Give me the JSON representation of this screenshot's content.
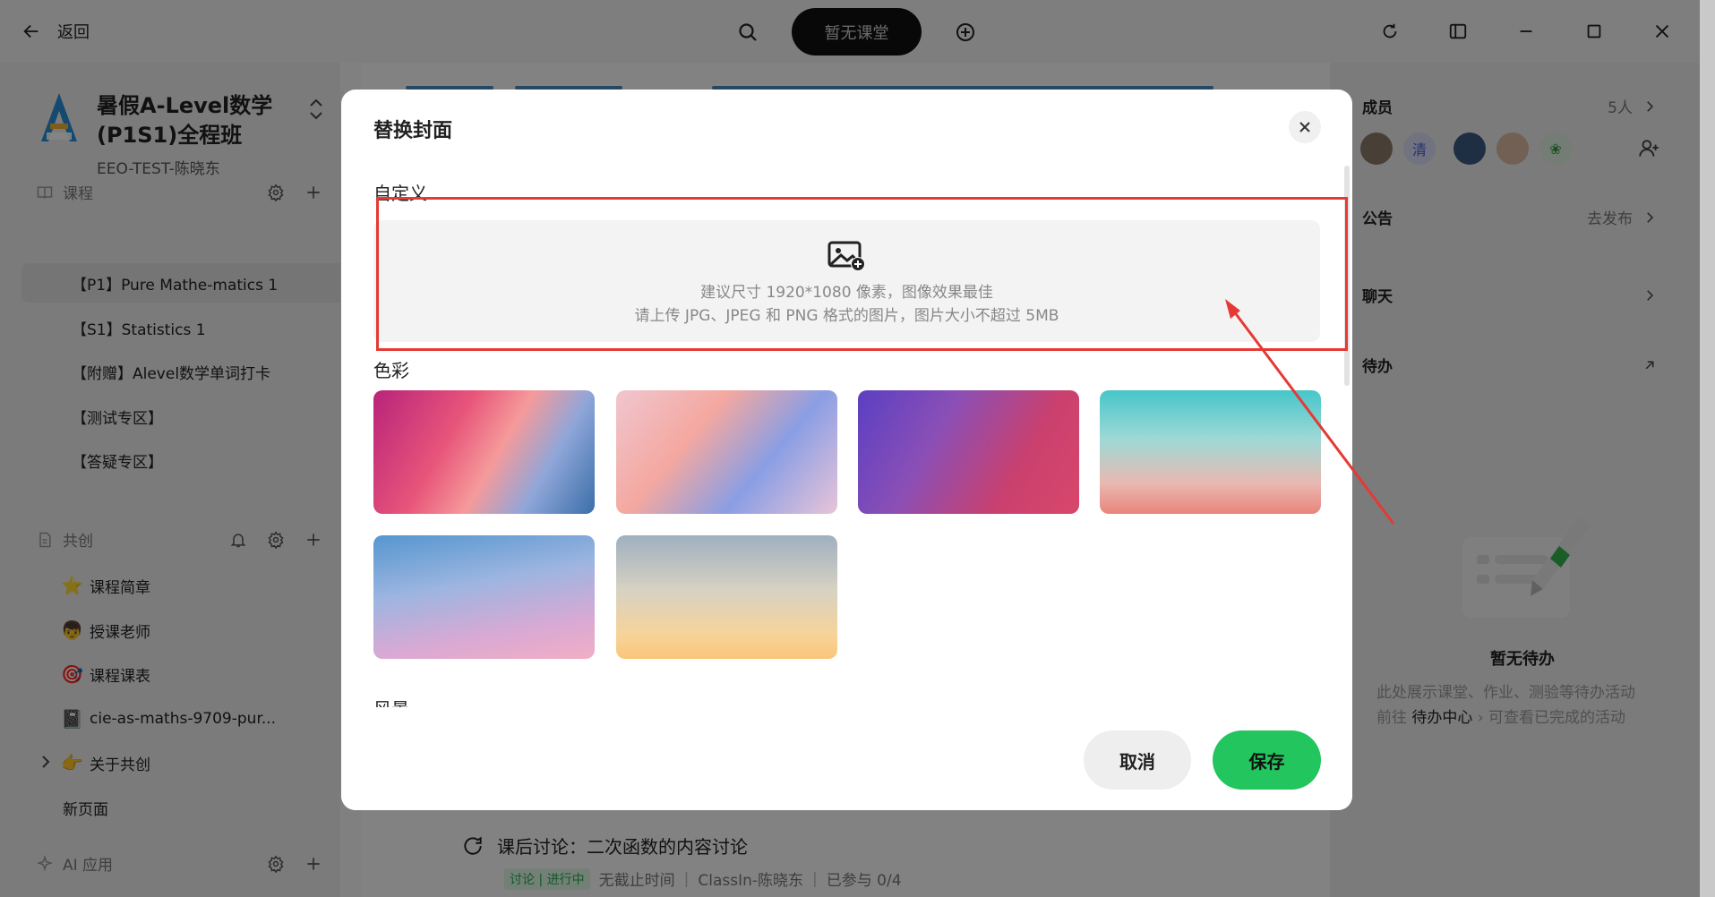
{
  "topbar": {
    "back_label": "返回",
    "class_status": "暂无课堂"
  },
  "sidebar": {
    "course_title": "暑假A-Level数学(P1S1)全程班",
    "course_sub": "EEO-TEST-陈晓东",
    "sections": {
      "course": "课程",
      "cocreate": "共创",
      "ai": "AI 应用"
    },
    "course_items": [
      {
        "label": "【P1】Pure Mathe-matics 1",
        "active": true
      },
      {
        "label": "【S1】Statistics 1"
      },
      {
        "label": "【附赠】Alevel数学单词打卡"
      },
      {
        "label": "【测试专区】"
      },
      {
        "label": "【答疑专区】"
      }
    ],
    "cocreate_items": [
      {
        "label": "课程简章",
        "icon": "star-icon",
        "glyph": "⭐"
      },
      {
        "label": "授课老师",
        "icon": "teacher-icon",
        "glyph": "👦"
      },
      {
        "label": "课程课表",
        "icon": "target-icon",
        "glyph": "🎯"
      },
      {
        "label": "cie-as-maths-9709-pur...",
        "icon": "notebook-icon",
        "glyph": "📓"
      },
      {
        "label": "关于共创",
        "icon": "pointing-hand-icon",
        "glyph": "👉"
      },
      {
        "label": "新页面"
      }
    ]
  },
  "main": {
    "discussion_title": "课后讨论：二次函数的内容讨论",
    "discussion_tag": "讨论 | 进行中",
    "discussion_deadline": "无截止时间",
    "discussion_author": "ClassIn-陈晓东",
    "discussion_progress": "已参与 0/4"
  },
  "right_panel": {
    "members_label": "成员",
    "members_count": "5人",
    "avatar_text": "清",
    "notice_label": "公告",
    "notice_action": "去发布",
    "chat_label": "聊天",
    "todo_label": "待办",
    "empty_title": "暂无待办",
    "empty_desc_line1": "此处展示课堂、作业、测验等待办活动",
    "empty_desc_pre": "前往",
    "empty_desc_link": "待办中心",
    "empty_desc_post": "可查看已完成的活动"
  },
  "modal": {
    "title": "替换封面",
    "custom_label": "自定义",
    "upload_hint_1": "建议尺寸 1920*1080 像素，图像效果最佳",
    "upload_hint_2": "请上传 JPG、JPEG 和 PNG 格式的图片，图片大小不超过 5MB",
    "color_label": "色彩",
    "scenery_label": "风景",
    "cancel_label": "取消",
    "save_label": "保存",
    "swatches": [
      {
        "gradient": "linear-gradient(120deg,#b8237a 0%,#e8557a 35%,#f59a9a 55%,#8fa6d9 75%,#3a6fa8 100%)"
      },
      {
        "gradient": "linear-gradient(130deg,#f0c6cf 0%,#f4a8a0 35%,#8a9ee4 65%,#e8c4d8 100%)"
      },
      {
        "gradient": "linear-gradient(120deg,#5a3fc2 0%,#8a4fb6 35%,#c9406f 70%,#d9476a 100%)"
      },
      {
        "gradient": "linear-gradient(180deg,#46c6c9 0%,#9fd9d6 40%,#e8b9b2 75%,#e8857c 100%)"
      },
      {
        "gradient": "linear-gradient(170deg,#5596cf 0%,#9db5e0 40%,#d9a9d4 75%,#f2aec4 100%)"
      },
      {
        "gradient": "linear-gradient(180deg,#9fb0c0 0%,#d8d2c2 45%,#f6d39a 80%,#fbc67a 100%)"
      }
    ]
  },
  "colors": {
    "accent_green": "#22c55e",
    "annotation_red": "#e53935"
  }
}
